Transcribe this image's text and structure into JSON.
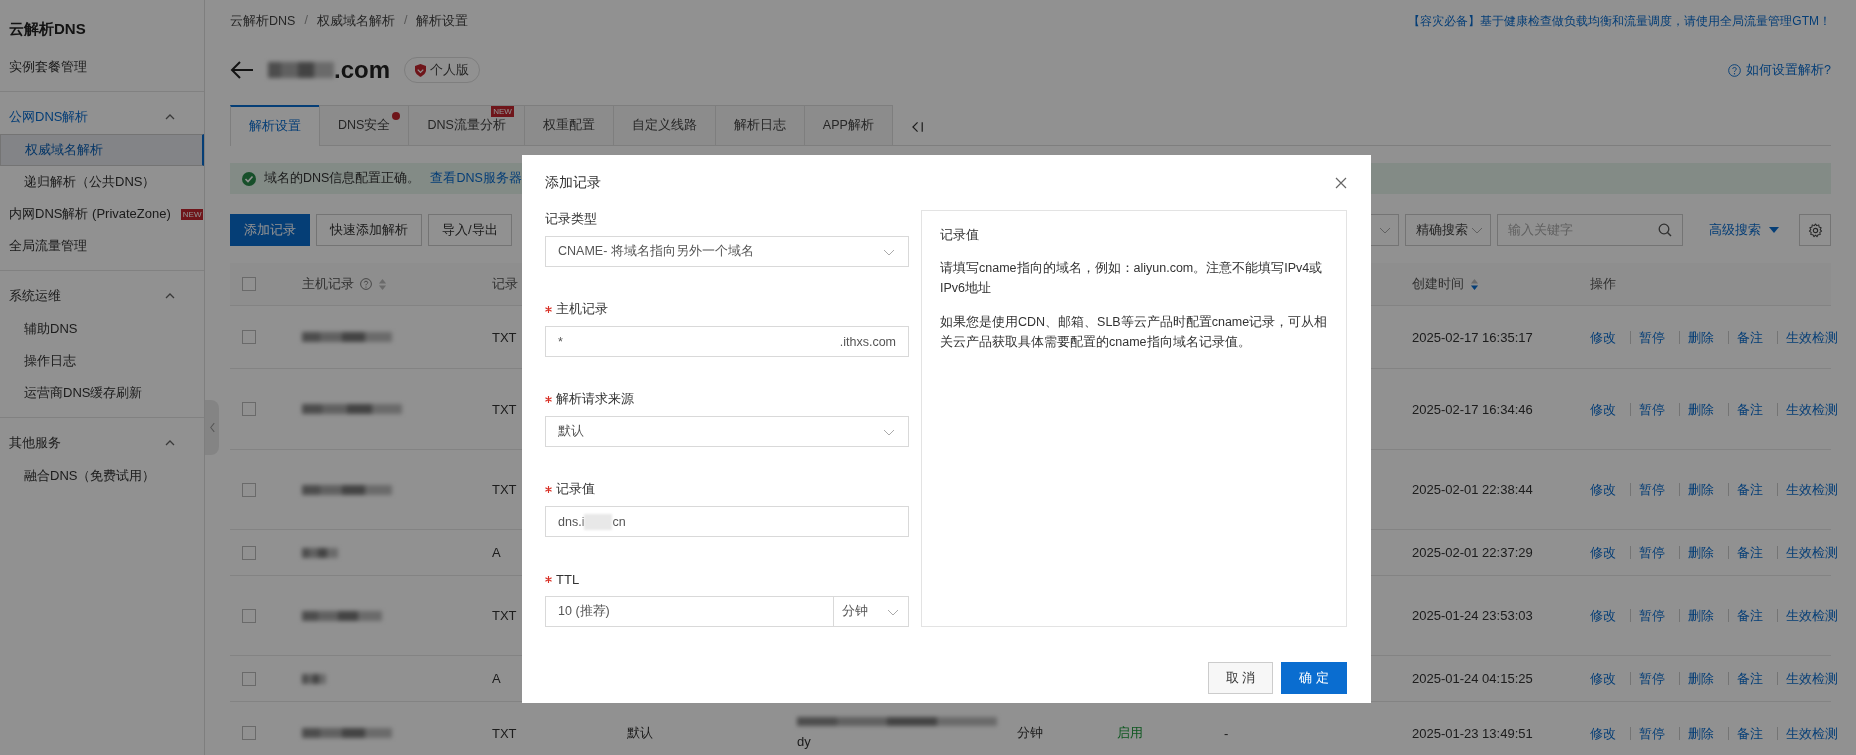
{
  "sidebar": {
    "title": "云解析DNS",
    "sections": [
      {
        "items": [
          {
            "label": "实例套餐管理",
            "selected": false
          }
        ]
      },
      {
        "items": [
          {
            "kind": "group",
            "label": "公网DNS解析",
            "expanded": true,
            "children": [
              {
                "label": "权威域名解析",
                "selected": true
              },
              {
                "label": "递归解析（公共DNS）",
                "selected": false
              }
            ]
          },
          {
            "label": "内网DNS解析 (PrivateZone)",
            "badge": "NEW",
            "selected": false
          },
          {
            "label": "全局流量管理",
            "selected": false
          }
        ]
      },
      {
        "items": [
          {
            "kind": "group",
            "label": "系统运维",
            "expanded": true,
            "children": [
              {
                "label": "辅助DNS",
                "selected": false
              },
              {
                "label": "操作日志",
                "selected": false
              },
              {
                "label": "运营商DNS缓存刷新",
                "selected": false
              }
            ]
          }
        ]
      },
      {
        "items": [
          {
            "kind": "group",
            "label": "其他服务",
            "expanded": true,
            "children": [
              {
                "label": "融合DNS（免费试用）",
                "selected": false
              }
            ]
          }
        ]
      }
    ]
  },
  "breadcrumb": [
    {
      "kind": "link",
      "text": "云解析DNS"
    },
    {
      "kind": "separator",
      "text": "/"
    },
    {
      "kind": "link",
      "text": "权威域名解析"
    },
    {
      "kind": "separator",
      "text": "/"
    },
    {
      "kind": "current",
      "text": "解析设置"
    }
  ],
  "header": {
    "domain_suffix": ".com",
    "edition": "个人版",
    "promo": "【容灾必备】基于健康检查做负载均衡和流量调度，请使用全局流量管理GTM！",
    "help_link": "如何设置解析?"
  },
  "tabs": [
    {
      "label": "解析设置",
      "selected": true,
      "dot": false
    },
    {
      "label": "DNS安全",
      "selected": false,
      "dot": true
    },
    {
      "label": "DNS流量分析",
      "selected": false,
      "dot": false,
      "badge": "NEW"
    },
    {
      "label": "权重配置",
      "selected": false,
      "dot": false
    },
    {
      "label": "自定义线路",
      "selected": false,
      "dot": false
    },
    {
      "label": "解析日志",
      "selected": false,
      "dot": false
    },
    {
      "label": "APP解析",
      "selected": false,
      "dot": false
    }
  ],
  "alert": {
    "message": "域名的DNS信息配置正确。",
    "link": "查看DNS服务器"
  },
  "toolbar": {
    "buttons": [
      {
        "label": "添加记录",
        "kind": "primary"
      },
      {
        "label": "快速添加解析",
        "kind": "default"
      },
      {
        "label": "导入/导出",
        "kind": "default"
      }
    ],
    "search_mode": "精确搜索",
    "search_placeholder": "输入关键字",
    "advanced_search": "高级搜索"
  },
  "table": {
    "header": {
      "checked": false,
      "host": {
        "label": "主机记录",
        "help": true,
        "sort_desc": false
      },
      "type": {
        "label": "记录"
      },
      "created": {
        "label": "创建时间",
        "sort_desc": true
      },
      "actions": {
        "label": "操作"
      }
    },
    "rows": [
      {
        "selected": false,
        "type": "TXT",
        "created": "2025-02-17 16:35:17",
        "actions": [
          "修改",
          "暂停",
          "删除",
          "备注",
          "生效检测"
        ]
      },
      {
        "selected": false,
        "type": "TXT",
        "created": "2025-02-17 16:34:46",
        "actions": [
          "修改",
          "暂停",
          "删除",
          "备注",
          "生效检测"
        ]
      },
      {
        "selected": false,
        "type": "TXT",
        "created": "2025-02-01 22:38:44",
        "actions": [
          "修改",
          "暂停",
          "删除",
          "备注",
          "生效检测"
        ]
      },
      {
        "selected": false,
        "type": "A",
        "created": "2025-02-01 22:37:29",
        "actions": [
          "修改",
          "暂停",
          "删除",
          "备注",
          "生效检测"
        ]
      },
      {
        "selected": false,
        "type": "TXT",
        "created": "2025-01-24 23:53:03",
        "actions": [
          "修改",
          "暂停",
          "删除",
          "备注",
          "生效检测"
        ]
      },
      {
        "selected": false,
        "type": "A",
        "created": "2025-01-24 04:15:25",
        "actions": [
          "修改",
          "暂停",
          "删除",
          "备注",
          "生效检测"
        ]
      },
      {
        "selected": false,
        "type": "TXT",
        "line": "默认",
        "value": "dy",
        "ttl": "分钟",
        "status": "启用",
        "remark": "-",
        "created": "2025-01-23 13:49:51",
        "actions": [
          "修改",
          "暂停",
          "删除",
          "备注",
          "生效检测"
        ]
      }
    ]
  },
  "modal": {
    "title": "添加记录",
    "fields": [
      {
        "kind": "select",
        "label": "记录类型",
        "required": false,
        "value": "CNAME- 将域名指向另外一个域名"
      },
      {
        "kind": "input",
        "label": "主机记录",
        "required": true,
        "value_parts": [
          "*"
        ],
        "suffix": ".ithxs.com"
      },
      {
        "kind": "select",
        "label": "解析请求来源",
        "required": true,
        "value": "默认"
      },
      {
        "kind": "input",
        "label": "记录值",
        "required": true,
        "value_parts": [
          "dns.i",
          "cn"
        ]
      },
      {
        "kind": "ttl",
        "label": "TTL",
        "required": true,
        "value": "10 (推荐)",
        "unit": "分钟"
      }
    ],
    "help": {
      "title": "记录值",
      "paragraphs": [
        "请填写cname指向的域名，例如：aliyun.com。注意不能填写IPv4或IPv6地址",
        "如果您是使用CDN、邮箱、SLB等云产品时配置cname记录，可从相关云产品获取具体需要配置的cname指向域名记录值。"
      ]
    },
    "buttons": [
      {
        "label": "取 消",
        "kind": "default"
      },
      {
        "label": "确 定",
        "kind": "primary"
      }
    ]
  }
}
